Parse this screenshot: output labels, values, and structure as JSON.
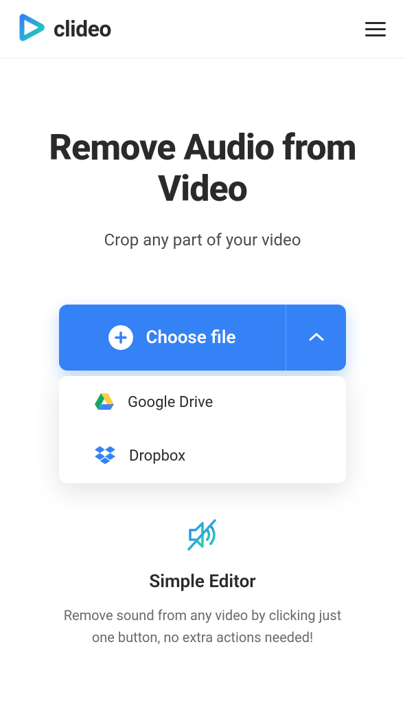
{
  "header": {
    "brand": "clideo"
  },
  "hero": {
    "title": "Remove Audio from Video",
    "subtitle": "Crop any part of your video"
  },
  "upload": {
    "button_label": "Choose file",
    "options": {
      "gdrive": "Google Drive",
      "dropbox": "Dropbox"
    }
  },
  "feature": {
    "title": "Simple Editor",
    "description": "Remove sound from any video by clicking just one button, no extra actions needed!"
  }
}
